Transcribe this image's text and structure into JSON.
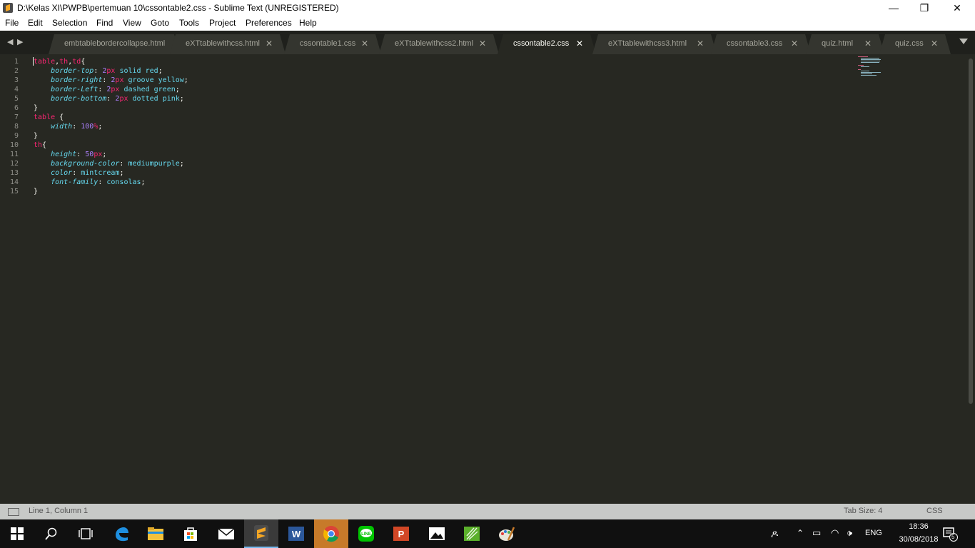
{
  "window": {
    "title": "D:\\Kelas XI\\PWPB\\pertemuan 10\\cssontable2.css - Sublime Text (UNREGISTERED)",
    "controls": {
      "minimize": "—",
      "restore": "❐",
      "close": "✕"
    }
  },
  "menu": [
    "File",
    "Edit",
    "Selection",
    "Find",
    "View",
    "Goto",
    "Tools",
    "Project",
    "Preferences",
    "Help"
  ],
  "tabs": [
    {
      "label": "embtablebordercollapse.html",
      "active": false,
      "close": ""
    },
    {
      "label": "eXTtablewithcss.html",
      "active": false,
      "close": "✕"
    },
    {
      "label": "cssontable1.css",
      "active": false,
      "close": "✕"
    },
    {
      "label": "eXTtablewithcss2.html",
      "active": false,
      "close": "✕"
    },
    {
      "label": "cssontable2.css",
      "active": true,
      "close": "✕"
    },
    {
      "label": "eXTtablewithcss3.html",
      "active": false,
      "close": "✕"
    },
    {
      "label": "cssontable3.css",
      "active": false,
      "close": "✕"
    },
    {
      "label": "quiz.html",
      "active": false,
      "close": "✕"
    },
    {
      "label": "quiz.css",
      "active": false,
      "close": "✕"
    }
  ],
  "editor": {
    "lines": [
      {
        "num": "1",
        "tokens": [
          [
            "sel",
            "table"
          ],
          [
            "plain",
            ","
          ],
          [
            "sel",
            "th"
          ],
          [
            "plain",
            ","
          ],
          [
            "sel",
            "td"
          ],
          [
            "plain",
            "{"
          ]
        ]
      },
      {
        "num": "2",
        "tokens": [
          [
            "plain",
            "    "
          ],
          [
            "prop",
            "border-top"
          ],
          [
            "plain",
            ": "
          ],
          [
            "num",
            "2"
          ],
          [
            "unit",
            "px"
          ],
          [
            "plain",
            " "
          ],
          [
            "val",
            "solid"
          ],
          [
            "plain",
            " "
          ],
          [
            "val",
            "red"
          ],
          [
            "plain",
            ";"
          ]
        ]
      },
      {
        "num": "3",
        "tokens": [
          [
            "plain",
            "    "
          ],
          [
            "prop",
            "border-right"
          ],
          [
            "plain",
            ": "
          ],
          [
            "num",
            "2"
          ],
          [
            "unit",
            "px"
          ],
          [
            "plain",
            " "
          ],
          [
            "val",
            "groove"
          ],
          [
            "plain",
            " "
          ],
          [
            "val",
            "yellow"
          ],
          [
            "plain",
            ";"
          ]
        ]
      },
      {
        "num": "4",
        "tokens": [
          [
            "plain",
            "    "
          ],
          [
            "prop",
            "border-Left"
          ],
          [
            "plain",
            ": "
          ],
          [
            "num",
            "2"
          ],
          [
            "unit",
            "px"
          ],
          [
            "plain",
            " "
          ],
          [
            "val",
            "dashed"
          ],
          [
            "plain",
            " "
          ],
          [
            "val",
            "green"
          ],
          [
            "plain",
            ";"
          ]
        ]
      },
      {
        "num": "5",
        "tokens": [
          [
            "plain",
            "    "
          ],
          [
            "prop",
            "border-bottom"
          ],
          [
            "plain",
            ": "
          ],
          [
            "num",
            "2"
          ],
          [
            "unit",
            "px"
          ],
          [
            "plain",
            " "
          ],
          [
            "val",
            "dotted"
          ],
          [
            "plain",
            " "
          ],
          [
            "val",
            "pink"
          ],
          [
            "plain",
            ";"
          ]
        ]
      },
      {
        "num": "6",
        "tokens": [
          [
            "plain",
            "}"
          ]
        ]
      },
      {
        "num": "7",
        "tokens": [
          [
            "sel",
            "table"
          ],
          [
            "plain",
            " {"
          ]
        ]
      },
      {
        "num": "8",
        "tokens": [
          [
            "plain",
            "    "
          ],
          [
            "prop",
            "width"
          ],
          [
            "plain",
            ": "
          ],
          [
            "num",
            "100"
          ],
          [
            "unit",
            "%"
          ],
          [
            "plain",
            ";"
          ]
        ]
      },
      {
        "num": "9",
        "tokens": [
          [
            "plain",
            "}"
          ]
        ]
      },
      {
        "num": "10",
        "tokens": [
          [
            "sel",
            "th"
          ],
          [
            "plain",
            "{"
          ]
        ]
      },
      {
        "num": "11",
        "tokens": [
          [
            "plain",
            "    "
          ],
          [
            "prop",
            "height"
          ],
          [
            "plain",
            ": "
          ],
          [
            "num",
            "50"
          ],
          [
            "unit",
            "px"
          ],
          [
            "plain",
            ";"
          ]
        ]
      },
      {
        "num": "12",
        "tokens": [
          [
            "plain",
            "    "
          ],
          [
            "prop",
            "background-color"
          ],
          [
            "plain",
            ": "
          ],
          [
            "val",
            "mediumpurple"
          ],
          [
            "plain",
            ";"
          ]
        ]
      },
      {
        "num": "13",
        "tokens": [
          [
            "plain",
            "    "
          ],
          [
            "prop",
            "color"
          ],
          [
            "plain",
            ": "
          ],
          [
            "val",
            "mintcream"
          ],
          [
            "plain",
            ";"
          ]
        ]
      },
      {
        "num": "14",
        "tokens": [
          [
            "plain",
            "    "
          ],
          [
            "prop",
            "font-family"
          ],
          [
            "plain",
            ": "
          ],
          [
            "val",
            "consolas"
          ],
          [
            "plain",
            ";"
          ]
        ]
      },
      {
        "num": "15",
        "tokens": [
          [
            "plain",
            "}"
          ]
        ]
      }
    ]
  },
  "status": {
    "position": "Line 1, Column 1",
    "tab_size": "Tab Size: 4",
    "syntax": "CSS"
  },
  "taskbar": {
    "apps": [
      {
        "name": "start-icon",
        "glyph": "start",
        "active": false
      },
      {
        "name": "search-icon",
        "glyph": "search",
        "active": false
      },
      {
        "name": "task-view-icon",
        "glyph": "taskview",
        "active": false
      },
      {
        "name": "edge-icon",
        "glyph": "edge",
        "active": false
      },
      {
        "name": "file-explorer-icon",
        "glyph": "folder",
        "active": false
      },
      {
        "name": "store-icon",
        "glyph": "store",
        "active": false
      },
      {
        "name": "mail-icon",
        "glyph": "mail",
        "active": false
      },
      {
        "name": "sublime-text-icon",
        "glyph": "sublime",
        "active": true
      },
      {
        "name": "word-icon",
        "glyph": "word",
        "active": false
      },
      {
        "name": "chrome-icon",
        "glyph": "chrome",
        "active": false
      },
      {
        "name": "line-icon",
        "glyph": "line",
        "active": false
      },
      {
        "name": "powerpoint-icon",
        "glyph": "ppt",
        "active": false
      },
      {
        "name": "photos-icon",
        "glyph": "photos",
        "active": false
      },
      {
        "name": "app-icon",
        "glyph": "green",
        "active": false
      },
      {
        "name": "paint-icon",
        "glyph": "paint",
        "active": false
      }
    ],
    "tray": {
      "language": "ENG",
      "time": "18:36",
      "date": "30/08/2018",
      "notifications": "5"
    }
  },
  "colors": {
    "background": "#272822",
    "selector": "#f92672",
    "property": "#66d9ef",
    "number": "#ae81ff",
    "plain": "#f8f8f2",
    "line_number": "#90908a"
  }
}
